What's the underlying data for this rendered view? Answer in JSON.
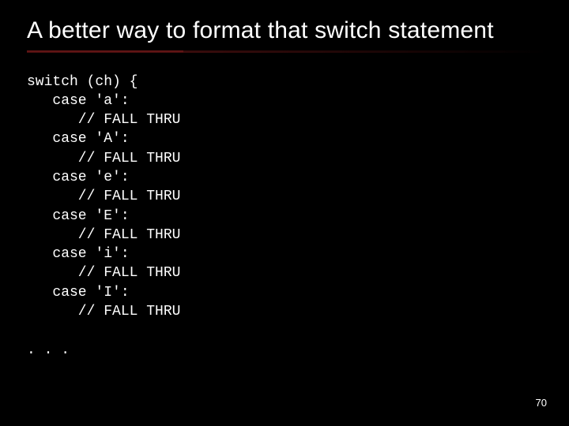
{
  "slide": {
    "title": "A better way to format that switch statement",
    "page_number": "70",
    "code_lines": [
      "switch (ch) {",
      "   case 'a':",
      "      // FALL THRU",
      "   case 'A':",
      "      // FALL THRU",
      "   case 'e':",
      "      // FALL THRU",
      "   case 'E':",
      "      // FALL THRU",
      "   case 'i':",
      "      // FALL THRU",
      "   case 'I':",
      "      // FALL THRU",
      "",
      ". . ."
    ]
  }
}
